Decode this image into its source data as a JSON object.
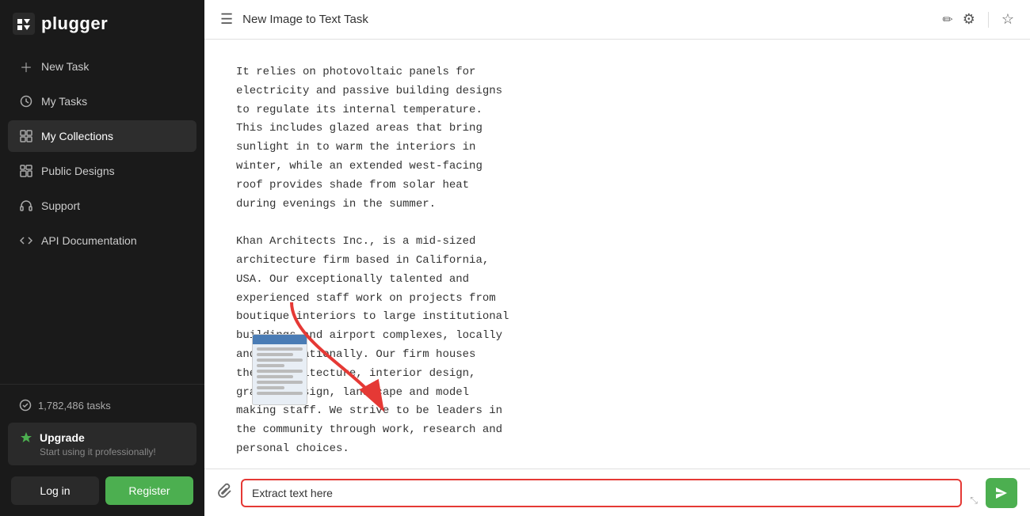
{
  "sidebar": {
    "logo": "plugger",
    "nav_items": [
      {
        "id": "new-task",
        "label": "New Task",
        "icon": "plus"
      },
      {
        "id": "my-tasks",
        "label": "My Tasks",
        "icon": "clock"
      },
      {
        "id": "my-collections",
        "label": "My Collections",
        "icon": "collection",
        "active": true
      },
      {
        "id": "public-designs",
        "label": "Public Designs",
        "icon": "grid"
      },
      {
        "id": "support",
        "label": "Support",
        "icon": "headphones"
      },
      {
        "id": "api-docs",
        "label": "API Documentation",
        "icon": "code"
      }
    ],
    "tasks_count": "1,782,486 tasks",
    "upgrade_title": "Upgrade",
    "upgrade_sub": "Start using it professionally!",
    "login_label": "Log in",
    "register_label": "Register"
  },
  "header": {
    "title": "New Image to Text Task",
    "menu_icon": "☰",
    "edit_icon": "✏",
    "settings_icon": "⚙",
    "star_icon": "☆"
  },
  "main": {
    "extracted_text": "It relies on photovoltaic panels for\nelectricity and passive building designs\nto regulate its internal temperature.\nThis includes glazed areas that bring\nsunlight in to warm the interiors in\nwinter, while an extended west-facing\nroof provides shade from solar heat\nduring evenings in the summer.\n\nKhan Architects Inc., is a mid-sized\narchitecture firm based in California,\nUSA. Our exceptionally talented and\nexperienced staff work on projects from\nboutique interiors to large institutional\nbuildings and airport complexes, locally\nand internationally. Our firm houses\ntheir architecture, interior design,\ngraphic design, landscape and model\nmaking staff. We strive to be leaders in\nthe community through work, research and\npersonal choices.",
    "input_placeholder": "Extract text here",
    "input_value": "Extract text here",
    "attach_icon": "📎",
    "send_icon": "➤"
  }
}
